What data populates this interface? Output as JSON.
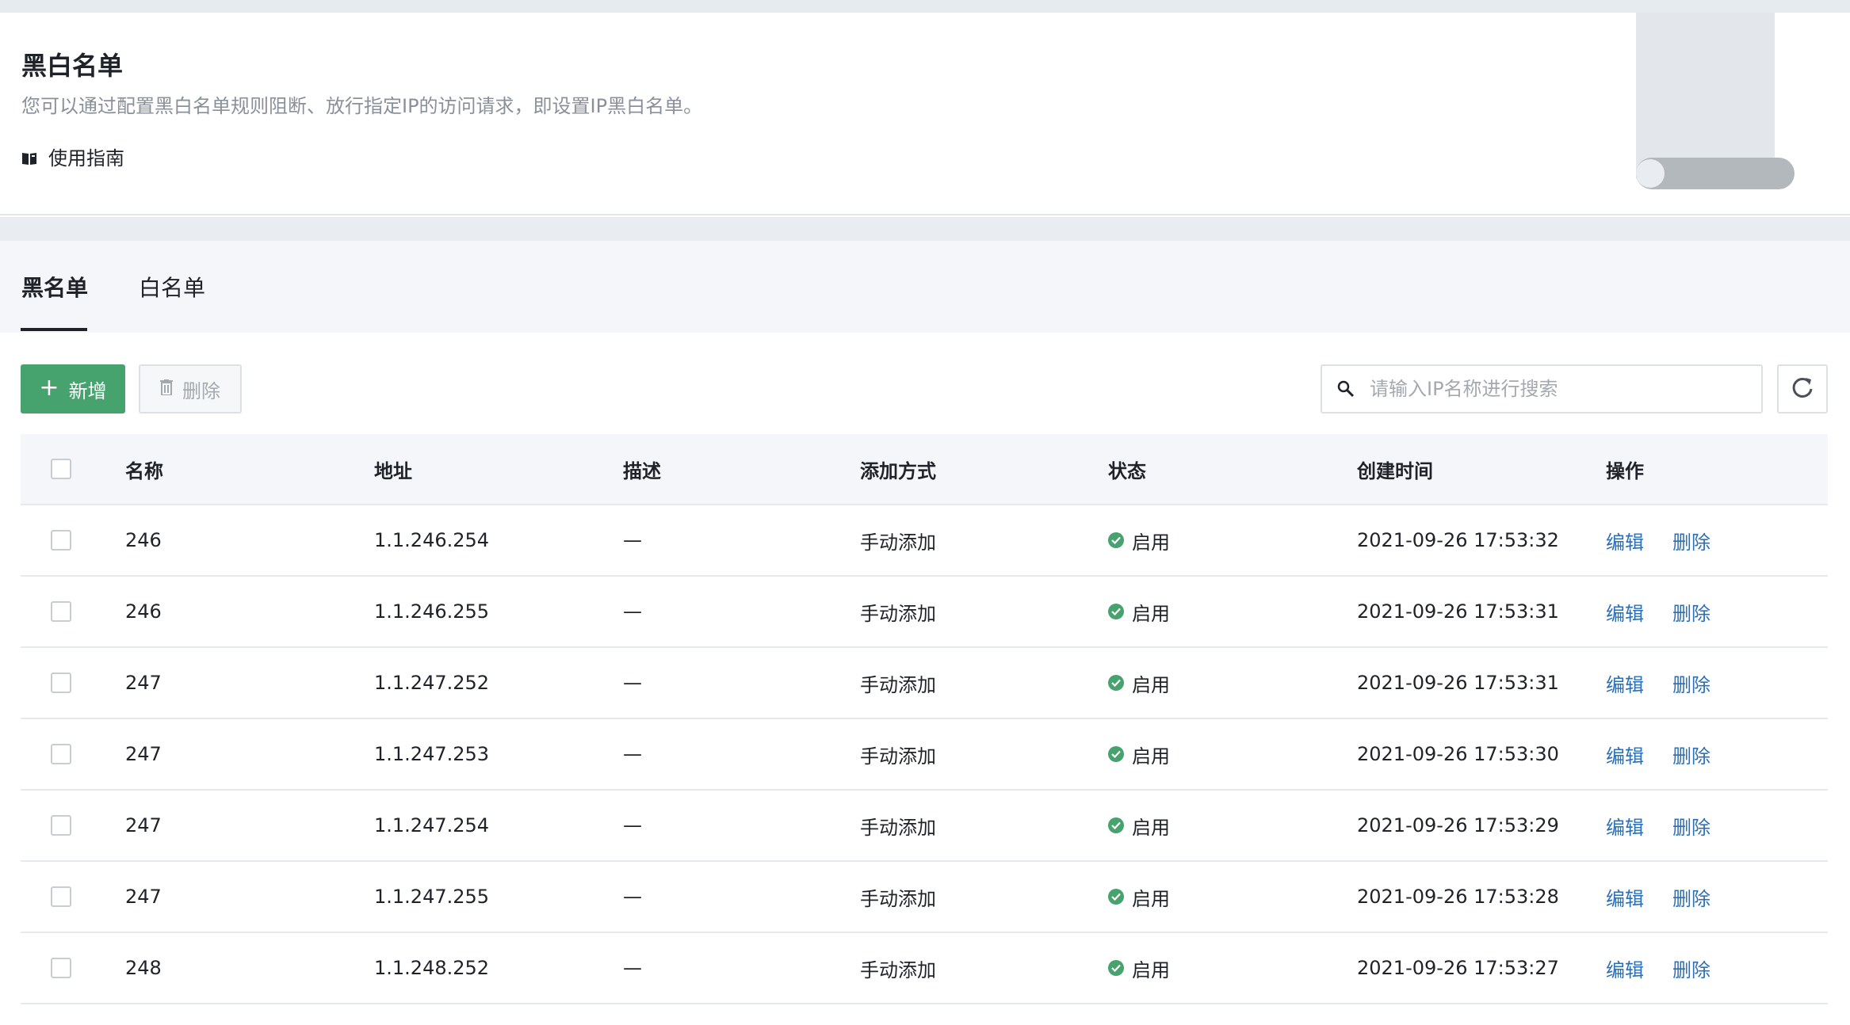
{
  "header": {
    "title": "黑白名单",
    "description": "您可以通过配置黑白名单规则阻断、放行指定IP的访问请求，即设置IP黑白名单。",
    "guide_label": "使用指南"
  },
  "tabs": [
    {
      "label": "黑名单",
      "active": true
    },
    {
      "label": "白名单",
      "active": false
    }
  ],
  "toolbar": {
    "add_label": "新增",
    "delete_label": "删除",
    "search_placeholder": "请输入IP名称进行搜索"
  },
  "table": {
    "columns": [
      "名称",
      "地址",
      "描述",
      "添加方式",
      "状态",
      "创建时间",
      "操作"
    ],
    "rows": [
      {
        "name": "246",
        "address": "1.1.246.254",
        "desc": "—",
        "method": "手动添加",
        "status": "启用",
        "created": "2021-09-26 17:53:32",
        "edit": "编辑",
        "delete": "删除"
      },
      {
        "name": "246",
        "address": "1.1.246.255",
        "desc": "—",
        "method": "手动添加",
        "status": "启用",
        "created": "2021-09-26 17:53:31",
        "edit": "编辑",
        "delete": "删除"
      },
      {
        "name": "247",
        "address": "1.1.247.252",
        "desc": "—",
        "method": "手动添加",
        "status": "启用",
        "created": "2021-09-26 17:53:31",
        "edit": "编辑",
        "delete": "删除"
      },
      {
        "name": "247",
        "address": "1.1.247.253",
        "desc": "—",
        "method": "手动添加",
        "status": "启用",
        "created": "2021-09-26 17:53:30",
        "edit": "编辑",
        "delete": "删除"
      },
      {
        "name": "247",
        "address": "1.1.247.254",
        "desc": "—",
        "method": "手动添加",
        "status": "启用",
        "created": "2021-09-26 17:53:29",
        "edit": "编辑",
        "delete": "删除"
      },
      {
        "name": "247",
        "address": "1.1.247.255",
        "desc": "—",
        "method": "手动添加",
        "status": "启用",
        "created": "2021-09-26 17:53:28",
        "edit": "编辑",
        "delete": "删除"
      },
      {
        "name": "248",
        "address": "1.1.248.252",
        "desc": "—",
        "method": "手动添加",
        "status": "启用",
        "created": "2021-09-26 17:53:27",
        "edit": "编辑",
        "delete": "删除"
      }
    ]
  },
  "colors": {
    "primary_green": "#46a36d",
    "link_blue": "#2d6fb7",
    "status_enabled": "#46a36d"
  },
  "icons": {
    "guide": "book-icon",
    "add": "plus-icon",
    "delete": "trash-icon",
    "search": "search-icon",
    "refresh": "refresh-icon",
    "status": "check-circle-icon"
  }
}
